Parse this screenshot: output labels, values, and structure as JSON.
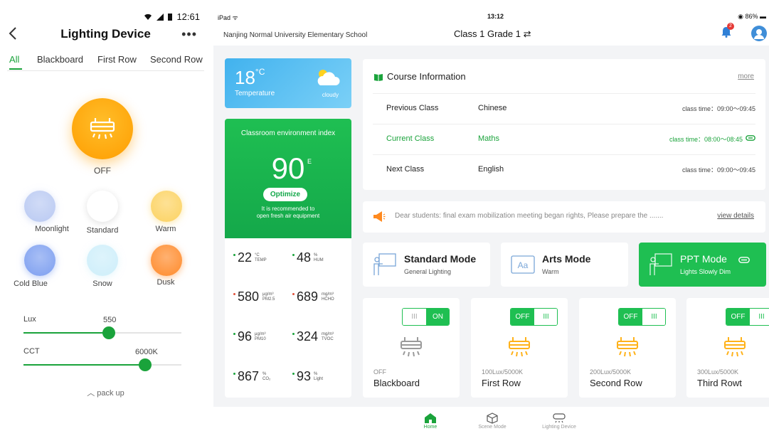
{
  "phone": {
    "status": {
      "time": "12:61"
    },
    "header": {
      "title": "Lighting Device",
      "more": "•••"
    },
    "tabs": [
      {
        "label": "All",
        "active": true
      },
      {
        "label": "Blackboard",
        "active": false
      },
      {
        "label": "First Row",
        "active": false
      },
      {
        "label": "Second Row",
        "active": false
      }
    ],
    "power_state": "OFF",
    "presets": [
      {
        "label": "Moonlight",
        "color": "#b9c9f2"
      },
      {
        "label": "Standard",
        "color": "#ffffff"
      },
      {
        "label": "Warm",
        "color": "#fcd260"
      },
      {
        "label": "Cold Blue",
        "color": "#7c9ef0"
      },
      {
        "label": "Snow",
        "color": "#cdeefa"
      },
      {
        "label": "Dusk",
        "color": "#ff8a2a"
      }
    ],
    "lux": {
      "label": "Lux",
      "value": "550",
      "fraction": 0.54
    },
    "cct": {
      "label": "CCT",
      "value": "6000K",
      "fraction": 0.77
    },
    "pack_up": "pack up",
    "accent_color": "#1aa33b"
  },
  "ipad": {
    "status": {
      "device": "iPad",
      "time": "13:12",
      "battery": "86%"
    },
    "school": "Nanjing Normal University Elementary School",
    "class_name": "Class 1 Grade 1",
    "notification_count": "2",
    "weather": {
      "temp": "18",
      "unit": "°C",
      "label": "Temperature",
      "condition": "cloudy"
    },
    "environment": {
      "title": "Classroom environment index",
      "score": "90",
      "grade": "E",
      "button": "Optimize",
      "recommendation_1": "It is recommended to",
      "recommendation_2": "open fresh air equipment"
    },
    "metrics": [
      {
        "value": "22",
        "unit_top": "°C",
        "unit_bottom": "TEMP",
        "dot": "#1aa33b"
      },
      {
        "value": "48",
        "unit_top": "%",
        "unit_bottom": "HUM",
        "dot": "#1aa33b"
      },
      {
        "value": "580",
        "unit_top": "μg/m³",
        "unit_bottom": "PM2.5",
        "dot": "#e0513b"
      },
      {
        "value": "689",
        "unit_top": "mg/m³",
        "unit_bottom": "HCHO",
        "dot": "#e0513b"
      },
      {
        "value": "96",
        "unit_top": "μg/m³",
        "unit_bottom": "PM10",
        "dot": "#1aa33b"
      },
      {
        "value": "324",
        "unit_top": "mg/m³",
        "unit_bottom": "TVOC",
        "dot": "#1aa33b"
      },
      {
        "value": "867",
        "unit_top": "%",
        "unit_bottom": "CO₂",
        "dot": "#1aa33b"
      },
      {
        "value": "93",
        "unit_top": "%",
        "unit_bottom": "Light",
        "dot": "#1aa33b"
      }
    ],
    "course": {
      "title": "Course Information",
      "more": "more",
      "rows": [
        {
          "label": "Previous Class",
          "subject": "Chinese",
          "time": "class time：09:00～09:45"
        },
        {
          "label": "Current Class",
          "subject": "Maths",
          "time": "class time：08:00～08:45"
        },
        {
          "label": "Next Class",
          "subject": "English",
          "time": "class time：09:00～09:45"
        }
      ]
    },
    "notice": {
      "text": "Dear students:  final exam mobilization meeting began rights, Please prepare the .......",
      "link": "view details"
    },
    "modes": [
      {
        "name": "Standard Mode",
        "sub": "General Lighting",
        "active": false
      },
      {
        "name": "Arts Mode",
        "sub": "Warm",
        "active": false
      },
      {
        "name": "PPT Mode",
        "sub": "Lights Slowly Dim",
        "active": true
      }
    ],
    "lights": [
      {
        "name": "Blackboard",
        "status": "OFF",
        "toggle_left": "III",
        "toggle_right": "ON"
      },
      {
        "name": "First Row",
        "status": "100Lux/5000K",
        "toggle_left": "OFF",
        "toggle_right": "III"
      },
      {
        "name": "Second Row",
        "status": "200Lux/5000K",
        "toggle_left": "OFF",
        "toggle_right": "III"
      },
      {
        "name": "Third Rowt",
        "status": "300Lux/5000K",
        "toggle_left": "OFF",
        "toggle_right": "III"
      }
    ],
    "nav": [
      {
        "label": "Home",
        "active": true
      },
      {
        "label": "Scene Mode",
        "active": false
      },
      {
        "label": "Lighting Device",
        "active": false
      }
    ],
    "accent_color": "#1fbf52"
  }
}
